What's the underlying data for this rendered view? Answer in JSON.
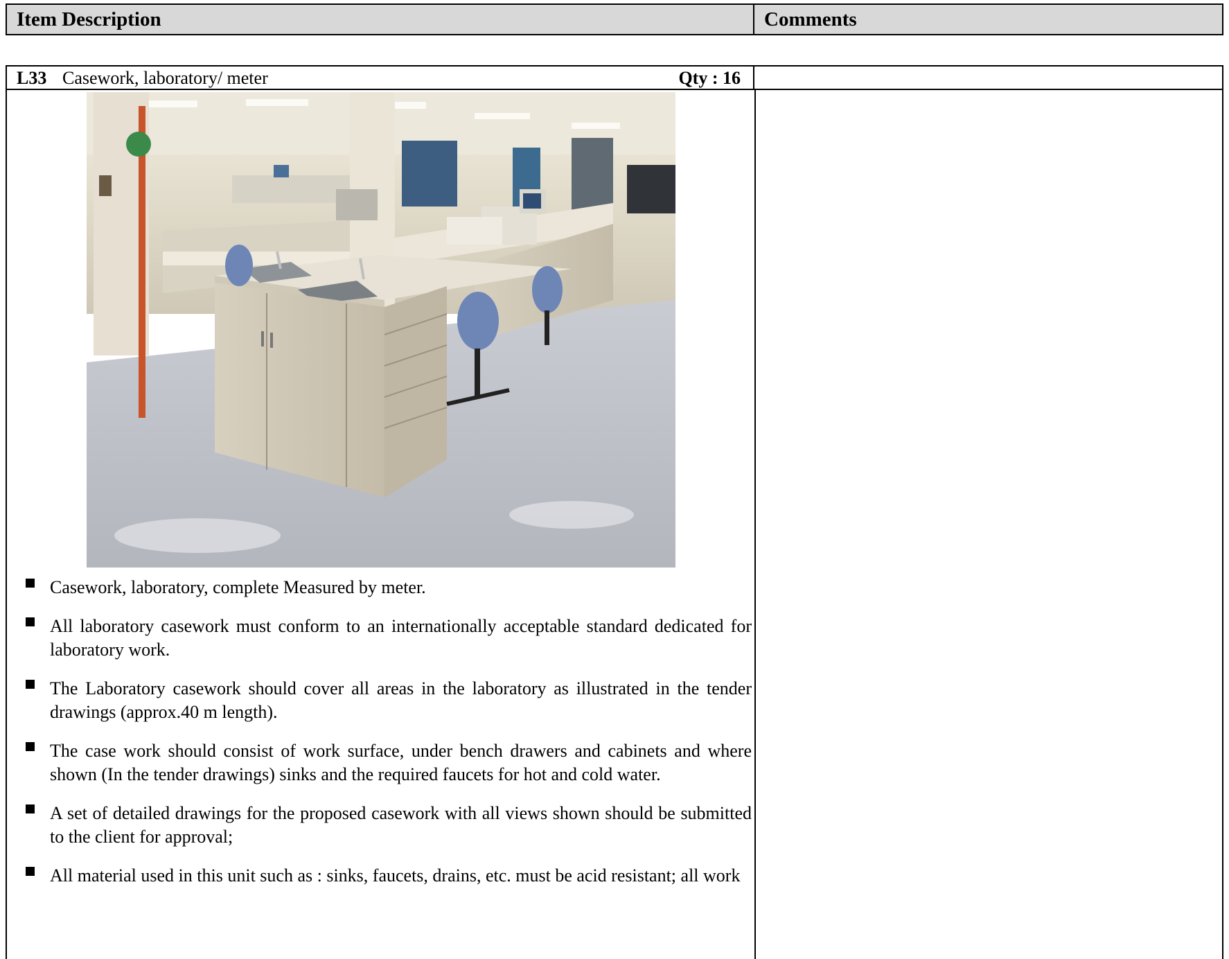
{
  "header": {
    "item_description": "Item Description",
    "comments": "Comments"
  },
  "item": {
    "code": "L33",
    "description": "Casework, laboratory/ meter",
    "qty": "Qty : 16",
    "photo_icon": "laboratory-casework-photo",
    "bullets": [
      "Casework, laboratory, complete Measured by meter.",
      "All laboratory casework must conform to an internationally acceptable standard dedicated for laboratory work.",
      "The Laboratory casework should cover all areas in the laboratory as illustrated in the tender drawings (approx.40 m length).",
      "The case work should consist of work surface, under bench drawers and cabinets and where shown (In the tender drawings) sinks and the required faucets for hot and cold water.",
      "A set of detailed drawings for the proposed casework with all views shown should be submitted to the client for approval;",
      "All  material used in this unit such as :  sinks, faucets, drains, etc. must be acid resistant; all work"
    ]
  }
}
